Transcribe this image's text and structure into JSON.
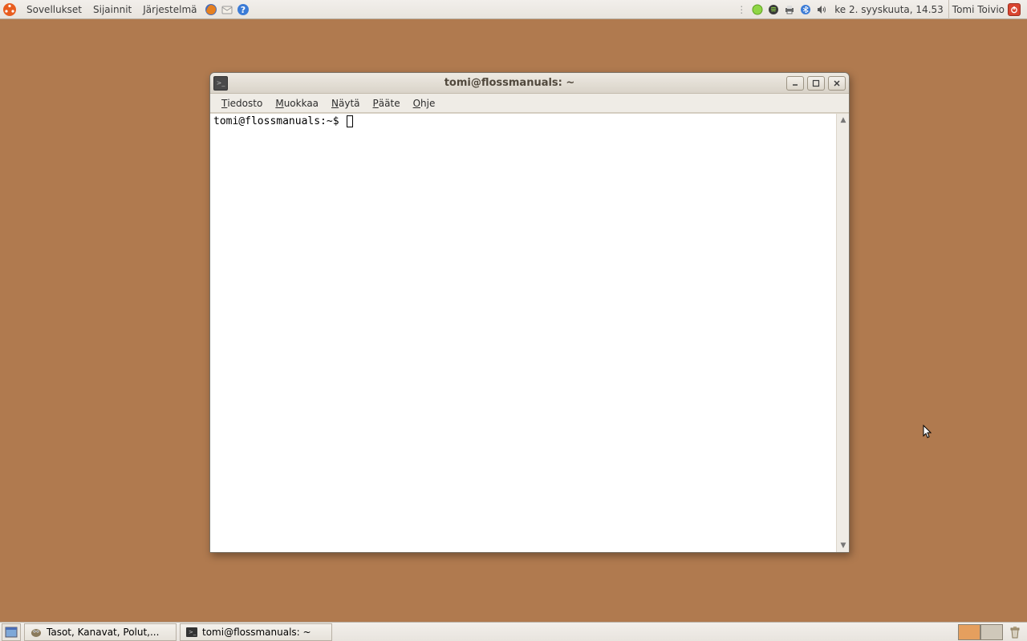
{
  "top_panel": {
    "menus": [
      "Sovellukset",
      "Sijainnit",
      "Järjestelmä"
    ],
    "clock": "ke  2. syyskuuta, 14.53",
    "user": "Tomi Toivio"
  },
  "terminal": {
    "title": "tomi@flossmanuals: ~",
    "menubar": [
      {
        "label": "Tiedosto",
        "accel": "T"
      },
      {
        "label": "Muokkaa",
        "accel": "M"
      },
      {
        "label": "Näytä",
        "accel": "N"
      },
      {
        "label": "Pääte",
        "accel": "P"
      },
      {
        "label": "Ohje",
        "accel": "O"
      }
    ],
    "prompt": "tomi@flossmanuals:~$"
  },
  "bottom_panel": {
    "tasks": [
      {
        "label": "Tasot, Kanavat, Polut,...",
        "icon": "gimp"
      },
      {
        "label": "tomi@flossmanuals: ~",
        "icon": "terminal"
      }
    ]
  }
}
